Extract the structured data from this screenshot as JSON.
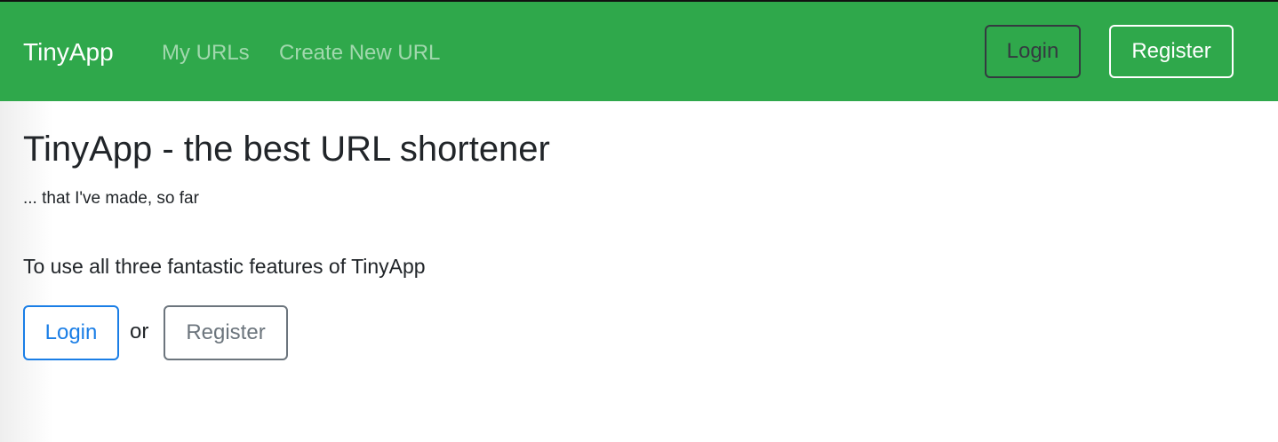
{
  "navbar": {
    "brand": "TinyApp",
    "links": [
      {
        "label": "My URLs"
      },
      {
        "label": "Create New URL"
      }
    ],
    "login_label": "Login",
    "register_label": "Register"
  },
  "main": {
    "title": "TinyApp - the best URL shortener",
    "subtitle": "... that I've made, so far",
    "lead": "To use all three fantastic features of TinyApp",
    "login_label": "Login",
    "or_text": "or",
    "register_label": "Register"
  },
  "colors": {
    "navbar_bg": "#2fa84b",
    "primary": "#1a7ee6",
    "secondary": "#6c757d",
    "dark": "#343a40"
  }
}
